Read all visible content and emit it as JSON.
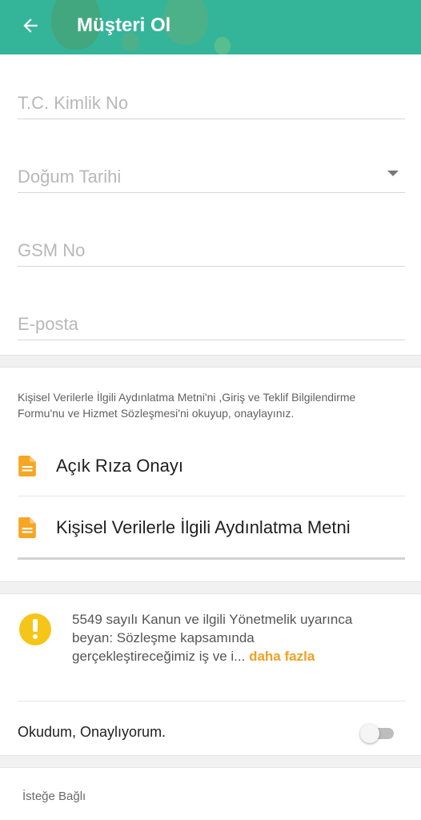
{
  "header": {
    "title": "Müşteri Ol",
    "back_icon": "arrow-left-icon",
    "background_color": "#34b59a"
  },
  "form": {
    "tc_placeholder": "T.C. Kimlik No",
    "birthdate_placeholder": "Doğum Tarihi",
    "gsm_placeholder": "GSM No",
    "email_placeholder": "E-posta"
  },
  "consent": {
    "intro": "Kişisel Verilerle İlgili Aydınlatma Metni'ni ,Giriş ve Teklif Bilgilendirme Formu'nu ve Hizmet Sözleşmesi'ni okuyup, onaylayınız.",
    "documents": [
      {
        "label": "Açık Rıza Onayı",
        "icon": "document-icon"
      },
      {
        "label": "Kişisel Verilerle İlgili Aydınlatma Metni",
        "icon": "document-icon"
      }
    ]
  },
  "notice": {
    "icon": "warning-icon",
    "text": "5549 sayılı Kanun ve ilgili Yönetmelik uyarınca beyan: Sözleşme kapsamında gerçekleştireceğimiz iş ve i...",
    "more_label": "daha fazla"
  },
  "agreement": {
    "label": "Okudum, Onaylıyorum.",
    "toggle_on": false
  },
  "optional_section": {
    "label": "İsteğe Bağlı"
  },
  "colors": {
    "accent": "#34b59a",
    "doc_icon": "#f5a623",
    "warning": "#f5c518",
    "link": "#f0a020"
  }
}
